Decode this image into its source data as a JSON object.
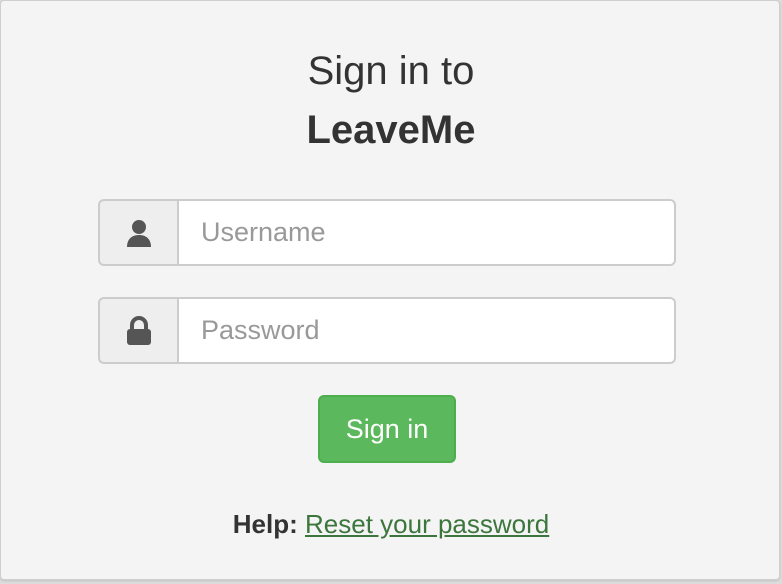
{
  "login": {
    "title_line1": "Sign in to",
    "title_line2": "LeaveMe",
    "username": {
      "placeholder": "Username",
      "value": "",
      "icon": "user-icon"
    },
    "password": {
      "placeholder": "Password",
      "value": "",
      "icon": "lock-icon"
    },
    "signin_label": "Sign in",
    "help_label": "Help:",
    "help_link": "Reset your password"
  },
  "colors": {
    "background": "#f4f4f4",
    "primary_button": "#5cb85c",
    "link": "#3c763d",
    "text": "#333333",
    "icon": "#555555"
  }
}
